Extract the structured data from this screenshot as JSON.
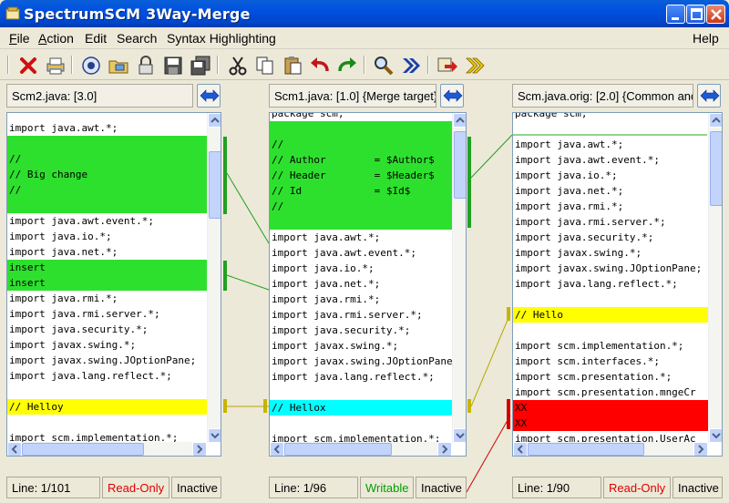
{
  "window": {
    "title": "SpectrumSCM 3Way-Merge"
  },
  "menu": [
    {
      "label": "File",
      "ul": "F",
      "rest": "ile"
    },
    {
      "label": "Action",
      "ul": "A",
      "rest": "ction"
    },
    {
      "label": "Edit",
      "ul": "",
      "rest": "Edit"
    },
    {
      "label": "Search",
      "ul": "",
      "rest": "Search"
    },
    {
      "label": "Syntax Highlighting",
      "ul": "",
      "rest": "Syntax Highlighting"
    },
    {
      "label": "Help",
      "ul": "",
      "rest": "Help"
    }
  ],
  "toolbar": {
    "icons": [
      "close-icon",
      "print-icon",
      "target-icon",
      "folder-open-icon",
      "lock-icon",
      "save-icon",
      "save-all-icon",
      "cut-icon",
      "copy-icon",
      "paste-icon",
      "undo-icon",
      "redo-icon",
      "find-icon",
      "next-diff-icon",
      "goto-icon",
      "next-conflict-icon"
    ]
  },
  "panes": [
    {
      "header": "Scm2.java: [3.0]",
      "status": {
        "line": "Line: 1/101",
        "mode": "Read-Only",
        "state": "Inactive"
      },
      "lines": [
        {
          "t": "import java.awt.*;",
          "c": ""
        },
        {
          "t": "",
          "c": "green"
        },
        {
          "t": "//",
          "c": "green"
        },
        {
          "t": "// Big change",
          "c": "green"
        },
        {
          "t": "//",
          "c": "green"
        },
        {
          "t": "",
          "c": "green"
        },
        {
          "t": "import java.awt.event.*;",
          "c": ""
        },
        {
          "t": "import java.io.*;",
          "c": ""
        },
        {
          "t": "import java.net.*;",
          "c": ""
        },
        {
          "t": "insert",
          "c": "green"
        },
        {
          "t": "insert",
          "c": "green"
        },
        {
          "t": "import java.rmi.*;",
          "c": ""
        },
        {
          "t": "import java.rmi.server.*;",
          "c": ""
        },
        {
          "t": "import java.security.*;",
          "c": ""
        },
        {
          "t": "import javax.swing.*;",
          "c": ""
        },
        {
          "t": "import javax.swing.JOptionPane;",
          "c": ""
        },
        {
          "t": "import java.lang.reflect.*;",
          "c": ""
        },
        {
          "t": "",
          "c": ""
        },
        {
          "t": "// Helloy",
          "c": "yellow"
        },
        {
          "t": "",
          "c": ""
        },
        {
          "t": "import scm.implementation.*;",
          "c": ""
        }
      ]
    },
    {
      "header": "Scm1.java: [1.0] {Merge target}",
      "status": {
        "line": "Line: 1/96",
        "mode": "Writable",
        "state": "Inactive"
      },
      "lines": [
        {
          "t": "package scm;",
          "c": ""
        },
        {
          "t": "",
          "c": "green"
        },
        {
          "t": "//",
          "c": "green"
        },
        {
          "t": "// Author        = $Author$",
          "c": "green"
        },
        {
          "t": "// Header        = $Header$",
          "c": "green"
        },
        {
          "t": "// Id            = $Id$",
          "c": "green"
        },
        {
          "t": "//",
          "c": "green"
        },
        {
          "t": "",
          "c": "green"
        },
        {
          "t": "import java.awt.*;",
          "c": ""
        },
        {
          "t": "import java.awt.event.*;",
          "c": ""
        },
        {
          "t": "import java.io.*;",
          "c": ""
        },
        {
          "t": "import java.net.*;",
          "c": ""
        },
        {
          "t": "import java.rmi.*;",
          "c": ""
        },
        {
          "t": "import java.rmi.server.*;",
          "c": ""
        },
        {
          "t": "import java.security.*;",
          "c": ""
        },
        {
          "t": "import javax.swing.*;",
          "c": ""
        },
        {
          "t": "import javax.swing.JOptionPane;",
          "c": ""
        },
        {
          "t": "import java.lang.reflect.*;",
          "c": ""
        },
        {
          "t": "",
          "c": ""
        },
        {
          "t": "// Hellox",
          "c": "cyan"
        },
        {
          "t": "",
          "c": ""
        },
        {
          "t": "import scm.implementation.*;",
          "c": ""
        }
      ]
    },
    {
      "header": "Scm.java.orig: [2.0] {Common ancestor}",
      "status": {
        "line": "Line: 1/90",
        "mode": "Read-Only",
        "state": "Inactive"
      },
      "lines": [
        {
          "t": "package scm;",
          "c": ""
        },
        {
          "t": "",
          "c": ""
        },
        {
          "t": "import java.awt.*;",
          "c": ""
        },
        {
          "t": "import java.awt.event.*;",
          "c": ""
        },
        {
          "t": "import java.io.*;",
          "c": ""
        },
        {
          "t": "import java.net.*;",
          "c": ""
        },
        {
          "t": "import java.rmi.*;",
          "c": ""
        },
        {
          "t": "import java.rmi.server.*;",
          "c": ""
        },
        {
          "t": "import java.security.*;",
          "c": ""
        },
        {
          "t": "import javax.swing.*;",
          "c": ""
        },
        {
          "t": "import javax.swing.JOptionPane;",
          "c": ""
        },
        {
          "t": "import java.lang.reflect.*;",
          "c": ""
        },
        {
          "t": "",
          "c": ""
        },
        {
          "t": "// Hello",
          "c": "yellow"
        },
        {
          "t": "",
          "c": ""
        },
        {
          "t": "import scm.implementation.*;",
          "c": ""
        },
        {
          "t": "import scm.interfaces.*;",
          "c": ""
        },
        {
          "t": "import scm.presentation.*;",
          "c": ""
        },
        {
          "t": "import scm.presentation.mngeCr",
          "c": ""
        },
        {
          "t": "XX",
          "c": "red"
        },
        {
          "t": "XX",
          "c": "red"
        },
        {
          "t": "import scm.presentation.UserAc",
          "c": ""
        }
      ]
    }
  ],
  "colors": {
    "green": "#2ee02e",
    "yellow": "#ffff00",
    "cyan": "#00ffff",
    "red": "#ff0000",
    "readonly": "#e00000",
    "writable": "#00a000"
  }
}
